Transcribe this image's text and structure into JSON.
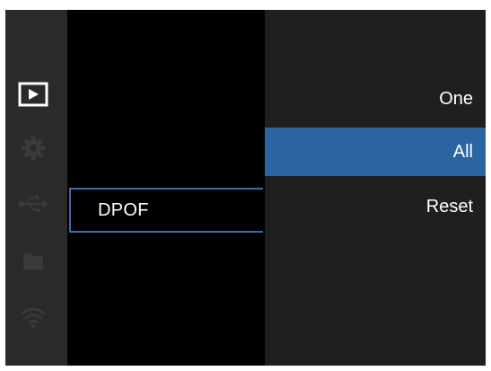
{
  "sidebar": {
    "icons": [
      {
        "name": "playback-icon",
        "active": true
      },
      {
        "name": "gear-icon",
        "active": false
      },
      {
        "name": "usb-icon",
        "active": false
      },
      {
        "name": "folder-icon",
        "active": false
      },
      {
        "name": "wifi-icon",
        "active": false
      }
    ]
  },
  "menu": {
    "selected_item": "DPOF"
  },
  "options": [
    {
      "label": "One",
      "selected": false
    },
    {
      "label": "All",
      "selected": true
    },
    {
      "label": "Reset",
      "selected": false
    }
  ],
  "colors": {
    "accent": "#2b64a3",
    "outline": "#3c6ea6",
    "inactive_icon": "#3a3a3a",
    "active_icon": "#ffffff"
  }
}
